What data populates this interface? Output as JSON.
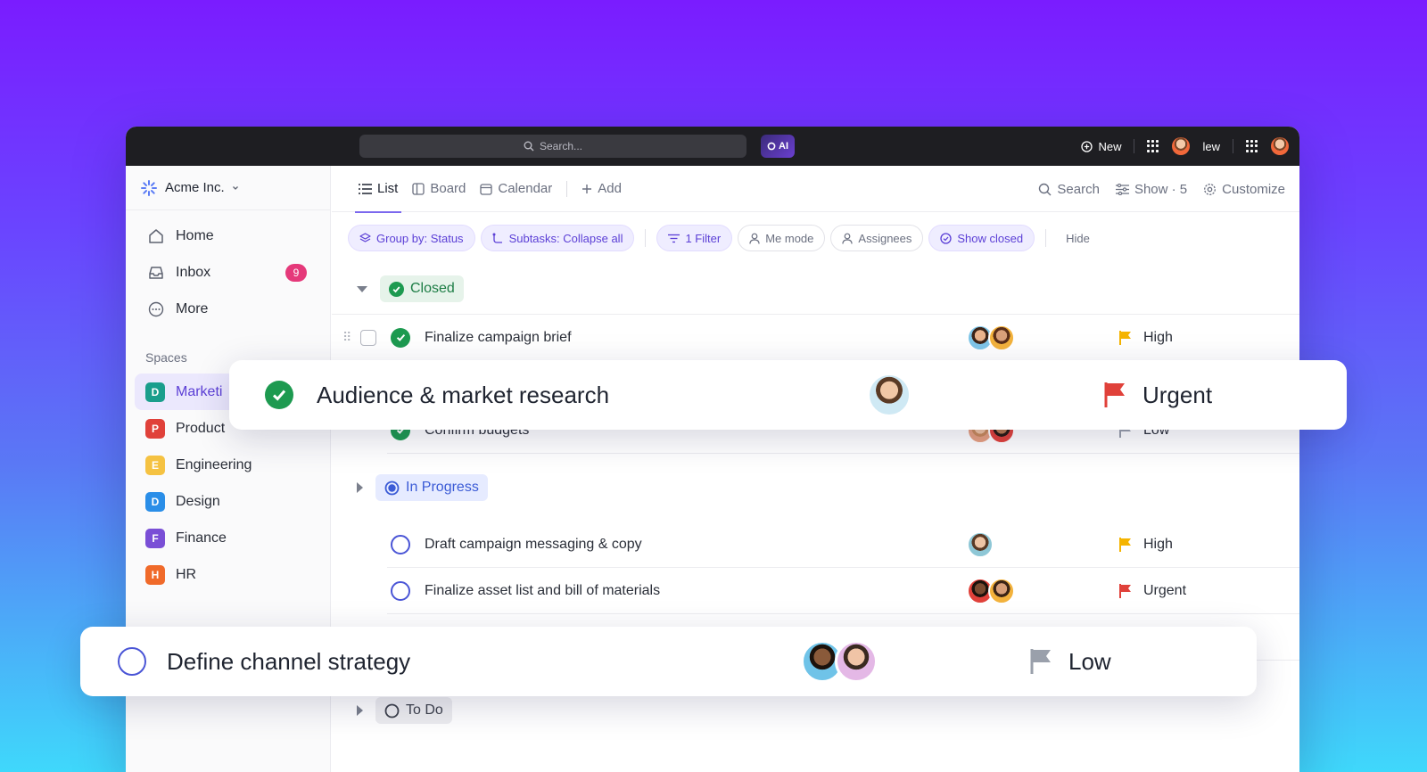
{
  "topbar": {
    "search_placeholder": "Search...",
    "ai_label": "AI",
    "new_label": "New",
    "new_label_2": "lew"
  },
  "sidebar": {
    "workspace": "Acme Inc.",
    "nav": [
      {
        "label": "Home",
        "icon": "home-icon"
      },
      {
        "label": "Inbox",
        "icon": "inbox-icon",
        "badge": "9"
      },
      {
        "label": "More",
        "icon": "more-icon"
      }
    ],
    "spaces_title": "Spaces",
    "spaces": [
      {
        "letter": "D",
        "label": "Marketi",
        "color": "#1a9e8c"
      },
      {
        "letter": "P",
        "label": "Product",
        "color": "#e0413a"
      },
      {
        "letter": "E",
        "label": "Engineering",
        "color": "#f5c242"
      },
      {
        "letter": "D",
        "label": "Design",
        "color": "#2a8ee8"
      },
      {
        "letter": "F",
        "label": "Finance",
        "color": "#7a4fd6"
      },
      {
        "letter": "H",
        "label": "HR",
        "color": "#f06a2a"
      }
    ]
  },
  "views": {
    "list": "List",
    "board": "Board",
    "calendar": "Calendar",
    "add": "Add",
    "search": "Search",
    "show": "Show · 5",
    "customize": "Customize"
  },
  "chips": {
    "group_by": "Group by: Status",
    "subtasks": "Subtasks: Collapse all",
    "filter": "1 Filter",
    "me_mode": "Me mode",
    "assignees": "Assignees",
    "show_closed": "Show closed",
    "hide": "Hide"
  },
  "groups": {
    "closed": "Closed",
    "in_progress": "In Progress",
    "todo": "To Do"
  },
  "tasks": {
    "t1": {
      "name": "Finalize campaign brief",
      "priority": "High"
    },
    "t2": {
      "name": "Confirm budgets",
      "priority": "Low"
    },
    "t3": {
      "name": "Draft campaign messaging & copy",
      "priority": "High"
    },
    "t4": {
      "name": "Finalize asset list and bill of materials",
      "priority": "Urgent"
    }
  },
  "floating": {
    "card1": {
      "name": "Audience & market research",
      "priority": "Urgent"
    },
    "card2": {
      "name": "Define channel strategy",
      "priority": "Low"
    }
  },
  "colors": {
    "urgent": "#e0413a",
    "high": "#f5b400",
    "low": "#9aa0ab",
    "accent": "#7b68ee"
  }
}
